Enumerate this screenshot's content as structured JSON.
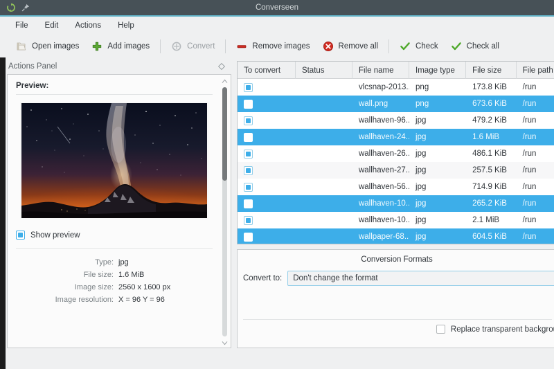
{
  "window": {
    "title": "Converseen",
    "icons": [
      "app-refresh-icon",
      "pin-icon"
    ]
  },
  "menubar": {
    "items": [
      {
        "label": "File"
      },
      {
        "label": "Edit"
      },
      {
        "label": "Actions"
      },
      {
        "label": "Help"
      }
    ]
  },
  "toolbar": {
    "buttons": [
      {
        "label": "Open images",
        "icon": "open-folder-icon",
        "enabled": true
      },
      {
        "label": "Add images",
        "icon": "plus-icon",
        "enabled": true
      },
      {
        "label": "Convert",
        "icon": "convert-icon",
        "enabled": false
      },
      {
        "label": "Remove images",
        "icon": "minus-icon",
        "enabled": true
      },
      {
        "label": "Remove all",
        "icon": "remove-all-icon",
        "enabled": true
      },
      {
        "label": "Check",
        "icon": "check-icon",
        "enabled": true
      },
      {
        "label": "Check all",
        "icon": "check-all-icon",
        "enabled": true
      }
    ]
  },
  "actions_panel": {
    "title": "Actions Panel",
    "float_icon": "float-diamond-icon",
    "preview_label": "Preview:",
    "preview_image_alt": "milky-way-over-mountains",
    "show_preview": {
      "label": "Show preview",
      "checked": true
    },
    "metadata": [
      {
        "key": "Type:",
        "value": "jpg"
      },
      {
        "key": "File size:",
        "value": "1.6 MiB"
      },
      {
        "key": "Image size:",
        "value": "2560 x 1600 px"
      },
      {
        "key": "Image resolution:",
        "value": "X = 96 Y = 96"
      }
    ]
  },
  "file_table": {
    "columns": [
      "To convert",
      "Status",
      "File name",
      "Image type",
      "File size",
      "File path"
    ],
    "rows": [
      {
        "checked": true,
        "selected": false,
        "status": "",
        "name": "vlcsnap-2013...",
        "type": "png",
        "size": "173.8 KiB",
        "path": "/run"
      },
      {
        "checked": false,
        "selected": true,
        "status": "",
        "name": "wall.png",
        "type": "png",
        "size": "673.6 KiB",
        "path": "/run"
      },
      {
        "checked": true,
        "selected": false,
        "status": "",
        "name": "wallhaven-96...",
        "type": "jpg",
        "size": "479.2 KiB",
        "path": "/run"
      },
      {
        "checked": false,
        "selected": true,
        "status": "",
        "name": "wallhaven-24...",
        "type": "jpg",
        "size": "1.6 MiB",
        "path": "/run"
      },
      {
        "checked": true,
        "selected": false,
        "status": "",
        "name": "wallhaven-26...",
        "type": "jpg",
        "size": "486.1 KiB",
        "path": "/run"
      },
      {
        "checked": true,
        "selected": false,
        "status": "",
        "name": "wallhaven-27...",
        "type": "jpg",
        "size": "257.5 KiB",
        "path": "/run"
      },
      {
        "checked": true,
        "selected": false,
        "status": "",
        "name": "wallhaven-56...",
        "type": "jpg",
        "size": "714.9 KiB",
        "path": "/run"
      },
      {
        "checked": false,
        "selected": true,
        "status": "",
        "name": "wallhaven-10...",
        "type": "jpg",
        "size": "265.2 KiB",
        "path": "/run"
      },
      {
        "checked": true,
        "selected": false,
        "status": "",
        "name": "wallhaven-10...",
        "type": "jpg",
        "size": "2.1 MiB",
        "path": "/run"
      },
      {
        "checked": false,
        "selected": true,
        "status": "",
        "name": "wallpaper-68...",
        "type": "jpg",
        "size": "604.5 KiB",
        "path": "/run"
      }
    ]
  },
  "conversion_formats": {
    "title": "Conversion Formats",
    "convert_to_label": "Convert to:",
    "convert_to_value": "Don't change the format",
    "replace_background": {
      "label": "Replace transparent backgrou",
      "checked": false
    }
  },
  "colors": {
    "titlebar": "#475157",
    "accent_line": "#61b3c8",
    "selection": "#3daee9",
    "panel_bg": "#eff0f1",
    "text": "#31363b"
  }
}
